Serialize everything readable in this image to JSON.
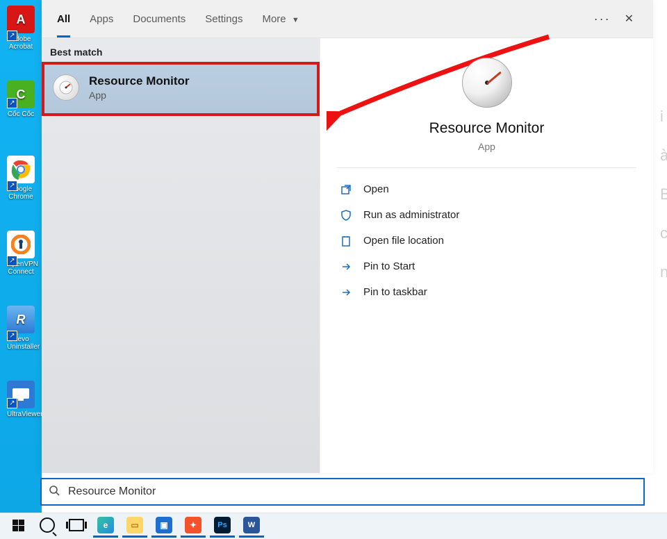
{
  "desktop": {
    "icons": [
      {
        "label": "Adobe Acrobat",
        "bg": "#d91616",
        "letter": "A"
      },
      {
        "label": "Cốc Cốc",
        "bg": "#48b021",
        "letter": "C"
      },
      {
        "label": "Google Chrome",
        "bg": "#fff",
        "letter": ""
      },
      {
        "label": "OpenVPN Connect",
        "bg": "#fff",
        "letter": ""
      },
      {
        "label": "Revo Uninstaller",
        "bg": "#2d79d4",
        "letter": "R"
      },
      {
        "label": "UltraViewer",
        "bg": "#2d79d4",
        "letter": ""
      }
    ]
  },
  "search": {
    "tabs": {
      "all": "All",
      "apps": "Apps",
      "documents": "Documents",
      "settings": "Settings",
      "more": "More"
    },
    "best_match_label": "Best match",
    "result": {
      "title": "Resource Monitor",
      "subtitle": "App"
    },
    "preview": {
      "title": "Resource Monitor",
      "subtitle": "App"
    },
    "actions": {
      "open": "Open",
      "admin": "Run as administrator",
      "location": "Open file location",
      "pin_start": "Pin to Start",
      "pin_taskbar": "Pin to taskbar"
    },
    "query": "Resource Monitor"
  },
  "bg_letters": "i à B c n"
}
